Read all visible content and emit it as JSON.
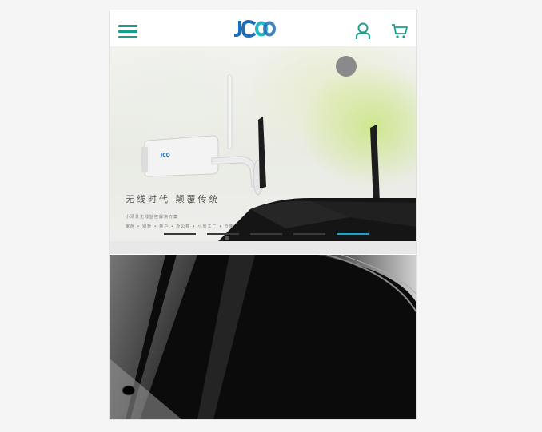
{
  "header": {
    "logo_text": "JCO",
    "colors": {
      "accent": "#1a9e8a",
      "logo_blue": "#1f6fb8",
      "logo_teal": "#20b7c8"
    },
    "icons": {
      "menu": "hamburger-icon",
      "user": "user-icon",
      "cart": "cart-icon"
    }
  },
  "hero": {
    "title": "无线时代 颠覆传统",
    "subtitle_1": "小场景无线监控解决方案",
    "subtitle_2": "家居 • 别墅 • 商户 • 办公楼 • 小型工厂 • 仓库",
    "camera_badge": "JCO",
    "carousel": {
      "slide_count": 5,
      "active_index": 4
    }
  }
}
